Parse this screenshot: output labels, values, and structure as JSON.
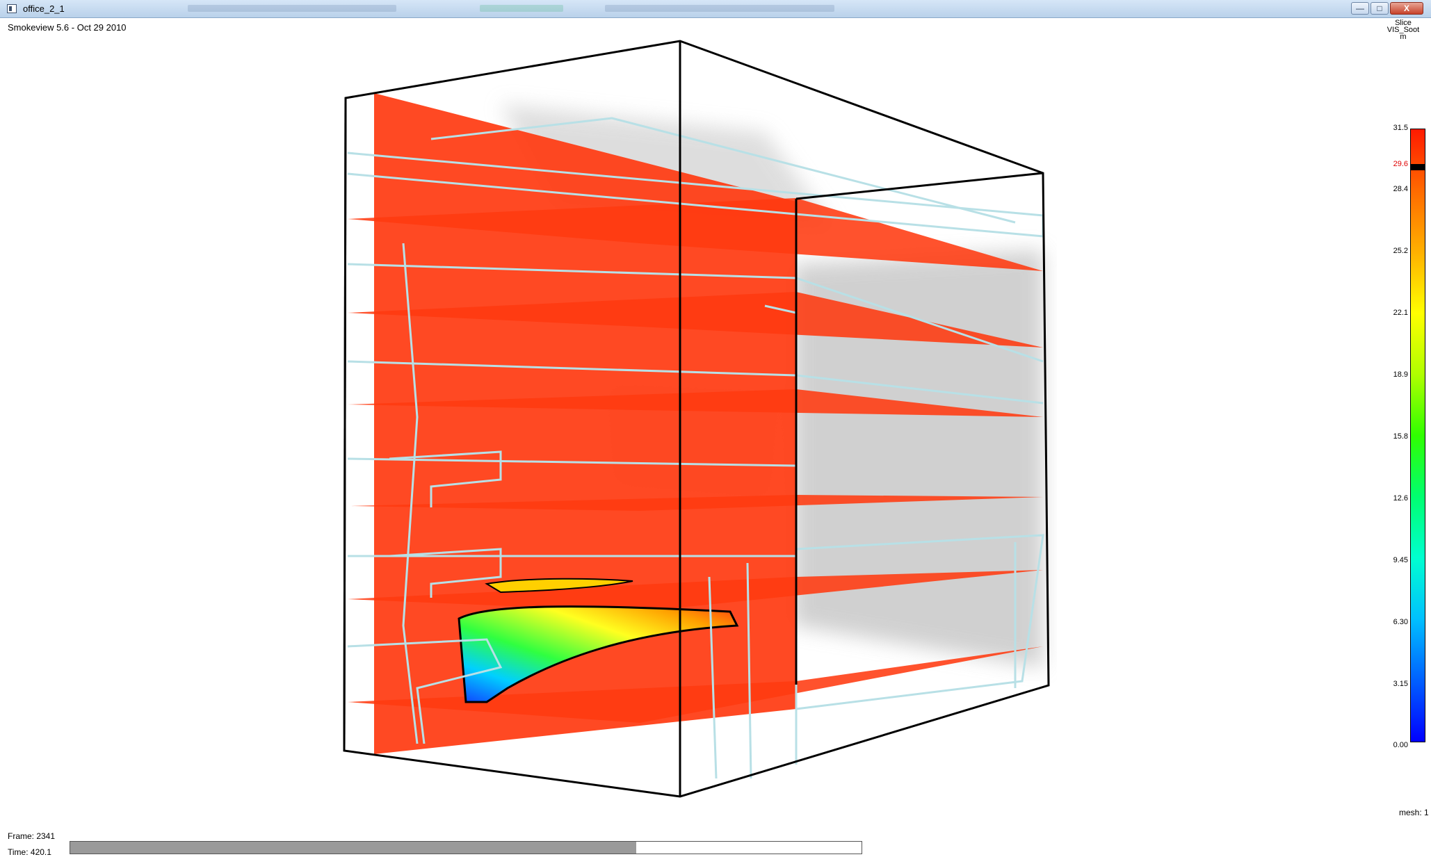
{
  "window": {
    "title": "office_2_1",
    "controls": {
      "minimize": "—",
      "maximize": "□",
      "close": "X"
    }
  },
  "app": {
    "version_label": "Smokeview 5.6 - Oct 29 2010"
  },
  "colorbar": {
    "title_lines": [
      "Slice",
      "VIS_Soot",
      "m"
    ],
    "ticks": [
      "31.5",
      "29.6",
      "28.4",
      "25.2",
      "22.1",
      "18.9",
      "15.8",
      "12.6",
      "9.45",
      "6.30",
      "3.15",
      "0.00"
    ],
    "current_value": "29.6",
    "current_color": "#e00000",
    "gradient_colors": [
      "#ff1a00",
      "#ff6a00",
      "#ffb000",
      "#ffff00",
      "#b0ff00",
      "#30ff00",
      "#00ff70",
      "#00ffd0",
      "#00c0ff",
      "#0060ff",
      "#0000ff"
    ]
  },
  "mesh_label": "mesh: 1",
  "status": {
    "frame": "Frame: 2341",
    "time": "Time: 420.1"
  },
  "timebar": {
    "progress": 0.715
  },
  "scene": {
    "content": "3D room with horizontal and vertical VIS_Soot slice planes",
    "slice_color": "#ff3a10",
    "outline_color": "#000000",
    "geometry_color": "#b8e0e6"
  }
}
